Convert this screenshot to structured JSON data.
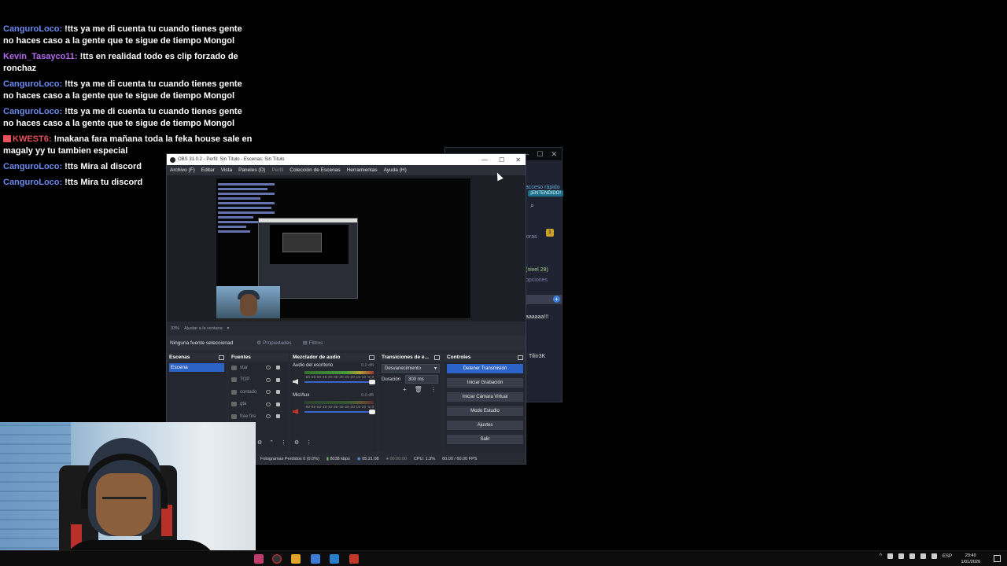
{
  "chat": [
    {
      "user": "CanguroLoco:",
      "color": "#6b8af0",
      "text": "!tts ya me di cuenta tu cuando tienes gente no haces caso a la gente que te sigue de tiempo Mongol"
    },
    {
      "user": "Kevin_Tasayco11:",
      "color": "#b46bf0",
      "text": "!tts en realidad todo es clip forzado de ronchaz"
    },
    {
      "user": "CanguroLoco:",
      "color": "#6b8af0",
      "text": "!tts ya me di cuenta tu cuando tienes gente no haces caso a la gente que te sigue de tiempo Mongol"
    },
    {
      "user": "CanguroLoco:",
      "color": "#6b8af0",
      "text": "!tts ya me di cuenta tu cuando tienes gente no haces caso a la gente que te sigue de tiempo Mongol"
    },
    {
      "user": "KWEST6:",
      "color": "#e8505b",
      "badge": true,
      "text": "!makana fara mañana toda la feka house sale en magaly yy tu tambien especial"
    },
    {
      "user": "CanguroLoco:",
      "color": "#6b8af0",
      "text": "!tts Mira al discord"
    },
    {
      "user": "CanguroLoco:",
      "color": "#6b8af0",
      "text": "!tts Mira tu discord"
    }
  ],
  "bg_window": {
    "acceso": "acceso rápido",
    "entendido": "¡ENTENDIDO!",
    "badge_count": "1",
    "nivel": "(nivel 28)",
    "opciones": "opciones",
    "msg": "aaaaaa!!!",
    "user": "Tilin3K",
    "frag1": "oras"
  },
  "obs": {
    "title": "OBS 31.0.2 - Perfil: Sin Título - Escenas: Sin Título",
    "menu": [
      "Archivo (F)",
      "Editar",
      "Vista",
      "Paneles (D)",
      "Perfil",
      "Colección de Escenas",
      "Herramientas",
      "Ayuda (H)"
    ],
    "zoom": "33%",
    "zoom_fit": "Ajustar a la ventana",
    "no_source": "Ninguna fuente seleccionad",
    "properties": "Propiedades",
    "filters": "Filtros",
    "docks": {
      "scenes": "Escenas",
      "sources": "Fuentes",
      "mixer": "Mezclador de audio",
      "transitions": "Transiciones de e...",
      "controls": "Controles"
    },
    "scene_item": "Escena",
    "sources": [
      "star",
      "TOP",
      "contado",
      "gta",
      "free fire"
    ],
    "mixer": [
      {
        "name": "Audio del escritorio",
        "db": "0.0 dB"
      },
      {
        "name": "Mic/Aux",
        "db": "0.0 dB"
      }
    ],
    "meter_scale": "-60-55-50-45-40-35-30-25-20-15-10 -5 0",
    "transition": "Desvanecimiento",
    "duration_label": "Duración",
    "duration_value": "300 ms",
    "controls": [
      "Detener Transmisión",
      "Iniciar Grabación",
      "Iniciar Cámara Virtual",
      "Modo Estudio",
      "Ajustes",
      "Salir"
    ],
    "status": {
      "dropped": "Fotogramas Perdidos 0 (0.0%)",
      "kbps": "8038 kbps",
      "live": "05:21:08",
      "rec": "00:00:00",
      "cpu": "CPU: 1.3%",
      "fps": "60.00 / 60.00 FPS"
    }
  },
  "taskbar": {
    "lang": "ESP",
    "time": "23:40",
    "date": "1/01/2026"
  }
}
